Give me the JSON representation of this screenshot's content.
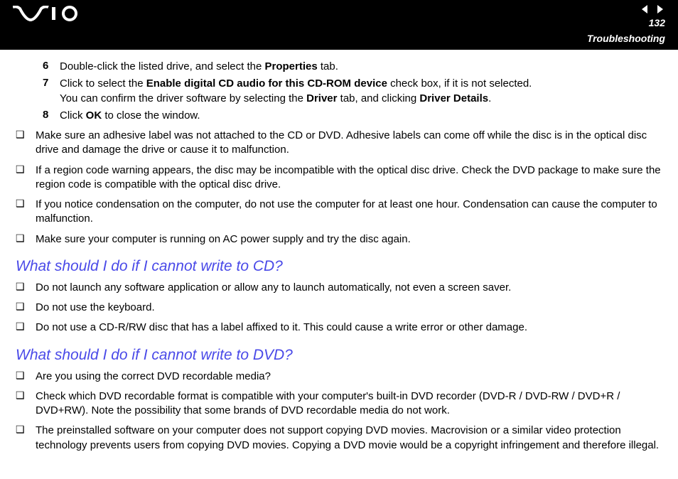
{
  "header": {
    "page_number": "132",
    "section": "Troubleshooting"
  },
  "steps": [
    {
      "num": "6",
      "parts": [
        {
          "text": "Double-click the listed drive, and select the "
        },
        {
          "text": "Properties",
          "bold": true
        },
        {
          "text": " tab."
        }
      ]
    },
    {
      "num": "7",
      "parts": [
        {
          "text": "Click to select the "
        },
        {
          "text": "Enable digital CD audio for this CD-ROM device",
          "bold": true
        },
        {
          "text": " check box, if it is not selected."
        },
        {
          "br": true
        },
        {
          "text": "You can confirm the driver software by selecting the "
        },
        {
          "text": "Driver",
          "bold": true
        },
        {
          "text": " tab, and clicking "
        },
        {
          "text": "Driver Details",
          "bold": true
        },
        {
          "text": "."
        }
      ]
    },
    {
      "num": "8",
      "parts": [
        {
          "text": "Click "
        },
        {
          "text": "OK",
          "bold": true
        },
        {
          "text": " to close the window."
        }
      ]
    }
  ],
  "bullets_top": [
    "Make sure an adhesive label was not attached to the CD or DVD. Adhesive labels can come off while the disc is in the optical disc drive and damage the drive or cause it to malfunction.",
    "If a region code warning appears, the disc may be incompatible with the optical disc drive. Check the DVD package to make sure the region code is compatible with the optical disc drive.",
    "If you notice condensation on the computer, do not use the computer for at least one hour. Condensation can cause the computer to malfunction.",
    "Make sure your computer is running on AC power supply and try the disc again."
  ],
  "heading_cd": "What should I do if I cannot write to CD?",
  "bullets_cd": [
    "Do not launch any software application or allow any to launch automatically, not even a screen saver.",
    "Do not use the keyboard.",
    "Do not use a CD-R/RW disc that has a label affixed to it. This could cause a write error or other damage."
  ],
  "heading_dvd": "What should I do if I cannot write to DVD?",
  "bullets_dvd": [
    "Are you using the correct DVD recordable media?",
    "Check which DVD recordable format is compatible with your computer's built-in DVD recorder (DVD-R / DVD-RW / DVD+R / DVD+RW). Note the possibility that some brands of DVD recordable media do not work.",
    "The preinstalled software on your computer does not support copying DVD movies. Macrovision or a similar video protection technology prevents users from copying DVD movies. Copying a DVD movie would be a copyright infringement and therefore illegal."
  ]
}
